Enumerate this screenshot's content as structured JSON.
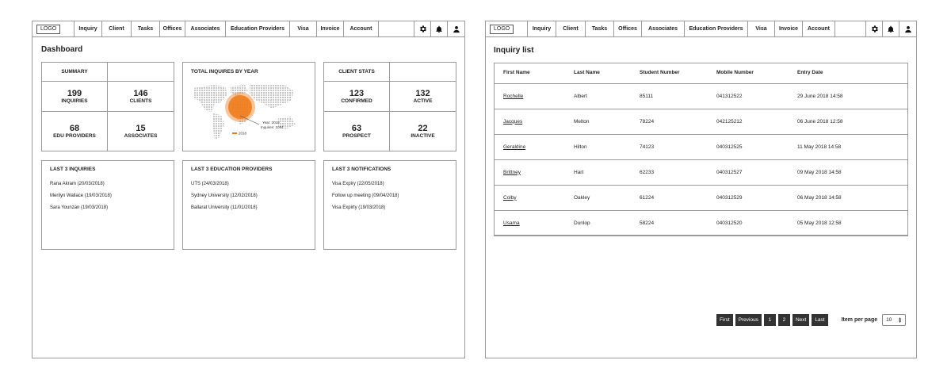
{
  "nav": {
    "logo": "LOGO",
    "items": [
      "Inquiry",
      "Client",
      "Tasks",
      "Offices",
      "Associates",
      "Education Providers",
      "Visa",
      "Invoice",
      "Account"
    ],
    "icons": [
      "gear-icon",
      "bell-icon",
      "user-icon"
    ]
  },
  "dashboard": {
    "title": "Dashboard",
    "summary": {
      "heading": "SUMMARY",
      "stats": [
        {
          "value": "199",
          "label": "INQUIRIES"
        },
        {
          "value": "146",
          "label": "CLIENTS"
        },
        {
          "value": "68",
          "label": "EDU PROVIDERS"
        },
        {
          "value": "15",
          "label": "ASSOCIATES"
        }
      ]
    },
    "map_panel": {
      "title": "TOTAL INQUIRES BY YEAR",
      "tooltip_year": "Year: 2018",
      "tooltip_value": "Inquires: 1084",
      "legend": "2018",
      "accent": "#f07d1d"
    },
    "client_stats": {
      "heading": "CLIENT STATS",
      "stats": [
        {
          "value": "123",
          "label": "CONFIRMED"
        },
        {
          "value": "132",
          "label": "ACTIVE"
        },
        {
          "value": "63",
          "label": "PROSPECT"
        },
        {
          "value": "22",
          "label": "INACTIVE"
        }
      ]
    },
    "last_inquiries": {
      "title": "LAST 3 INQUIRIES",
      "items": [
        "Rana Akram (20/03/2018)",
        "Merilyn Wallace (19/03/2018)",
        "Sara Younzan (19/03/2018)"
      ]
    },
    "last_providers": {
      "title": "LAST 3 EDUCATION PROVIDERS",
      "items": [
        "UTS (24/03/2018)",
        "Sydney University (12/02/2018)",
        "Ballarat University (11/01/2018)"
      ]
    },
    "last_notifications": {
      "title": "LAST 3 NOTIFICATIONS",
      "items": [
        "Visa Expiry (22/05/2018)",
        "Follow up meeting (09/04/2018)",
        "Visa Expirty (19/03/2018)"
      ]
    }
  },
  "inquiry_list": {
    "title": "Inquiry list",
    "columns": [
      "First Name",
      "Last Name",
      "Student Number",
      "Mobile Number",
      "Entry Date"
    ],
    "rows": [
      [
        "Rochelle",
        "Albert",
        "85111",
        "041312522",
        "29 June 2018 14:58"
      ],
      [
        "Jacques",
        "Melton",
        "78224",
        "042125212",
        "06 June 2018 12:58"
      ],
      [
        "Geraldine",
        "Hilton",
        "74123",
        "040312525",
        "11 May 2018 14:58"
      ],
      [
        "Brittney",
        "Hart",
        "62233",
        "040312527",
        "09 May 2018 14:58"
      ],
      [
        "Colby",
        "Oakley",
        "61224",
        "040312529",
        "06 May 2018 14:58"
      ],
      [
        "Usama",
        "Dunlop",
        "58224",
        "040312520",
        "05 May 2018 12:58"
      ]
    ],
    "pagination": {
      "buttons": [
        "First",
        "Previous",
        "1",
        "2",
        "Next",
        "Last"
      ],
      "items_per_page_label": "Item per page",
      "items_per_page_value": "10"
    }
  }
}
